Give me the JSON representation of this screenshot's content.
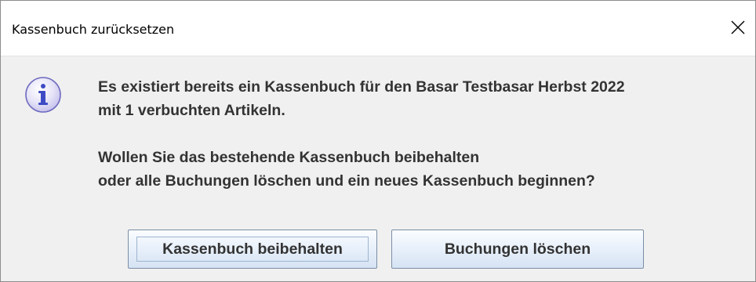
{
  "window": {
    "title": "Kassenbuch zurücksetzen",
    "close_icon": "close-icon"
  },
  "icon": {
    "name": "info-icon",
    "glyph": "i",
    "color": "#3e4bc4"
  },
  "message": {
    "line1": "Es existiert bereits ein Kassenbuch für den Basar Testbasar Herbst 2022",
    "line2": "mit 1 verbuchten Artikeln.",
    "line3": "Wollen Sie das bestehende Kassenbuch beibehalten",
    "line4": "oder alle Buchungen löschen und ein neues Kassenbuch beginnen?"
  },
  "buttons": {
    "keep_label": "Kassenbuch beibehalten",
    "delete_label": "Buchungen löschen"
  }
}
